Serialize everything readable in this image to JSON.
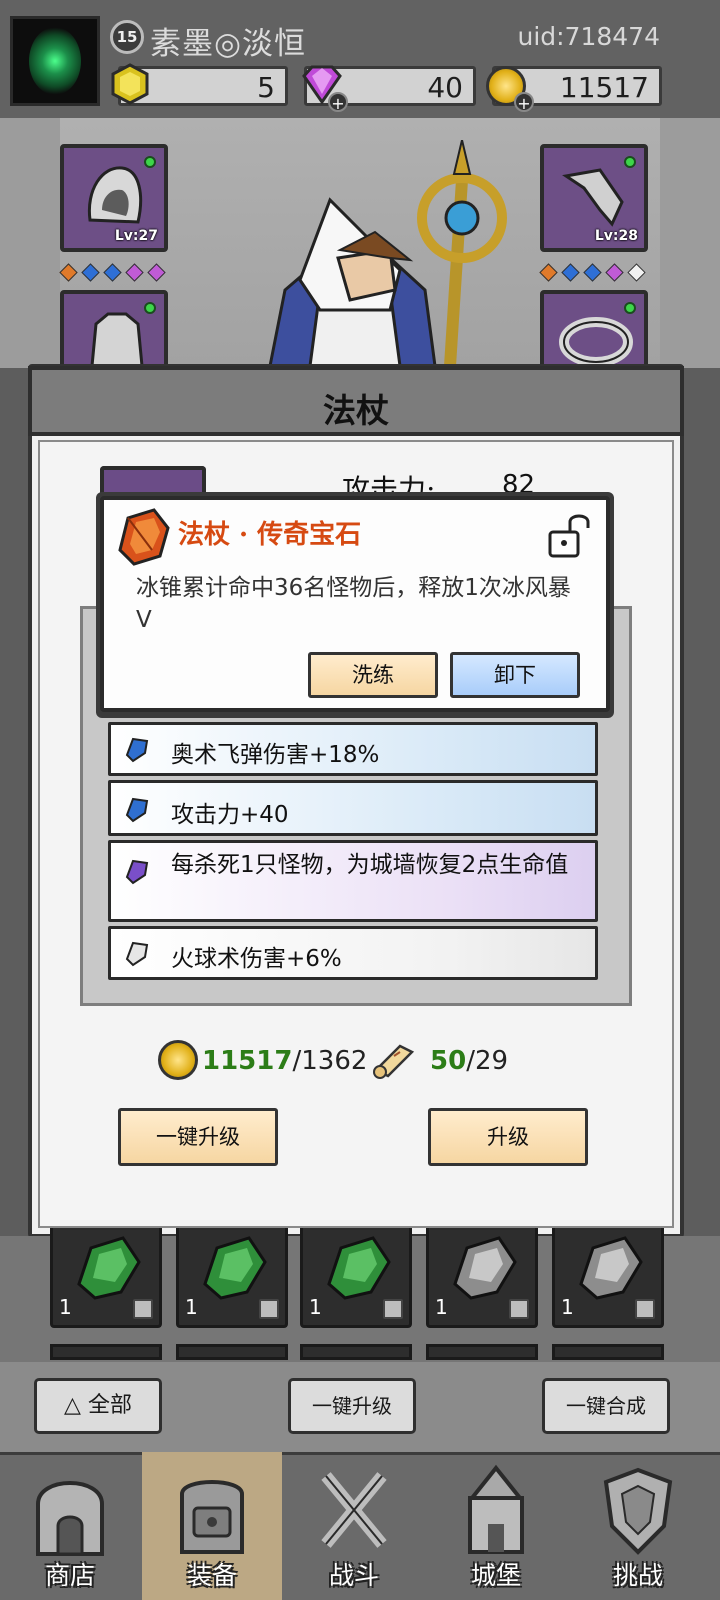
{
  "player": {
    "level": "15",
    "name": "素墨◎淡恒",
    "uid": "uid:718474"
  },
  "resources": {
    "gold_gem": "5",
    "diamond": "40",
    "coins": "11517"
  },
  "equipment": {
    "left_top_level": "Lv:27",
    "right_top_level": "Lv:28"
  },
  "panel": {
    "title": "法杖",
    "stat_label": "攻击力:",
    "stat_value": "82"
  },
  "popup": {
    "title": "法杖 · 传奇宝石",
    "description": "冰锥累计命中36名怪物后，释放1次冰风暴V",
    "reroll_label": "洗练",
    "unequip_label": "卸下"
  },
  "affixes": [
    {
      "text": "奥术飞弹伤害+18%",
      "gem_color": "#2f6fd1"
    },
    {
      "text": "攻击力+40",
      "gem_color": "#2f6fd1"
    },
    {
      "text": "每杀死1只怪物，为城墙恢复2点生命值",
      "gem_color": "#7a4fc9"
    },
    {
      "text": "火球术伤害+6%",
      "gem_color": "#e6e6e6"
    }
  ],
  "costs": {
    "coin_have": "11517",
    "coin_need": "/1362",
    "scroll_have": "50",
    "scroll_need": "/29"
  },
  "panel_buttons": {
    "upgrade_all": "一键升级",
    "upgrade": "升级"
  },
  "inventory": {
    "qty": "1"
  },
  "actions": {
    "filter_all": "全部",
    "upgrade_all": "一键升级",
    "merge_all": "一键合成"
  },
  "nav": [
    {
      "label": "商店"
    },
    {
      "label": "装备"
    },
    {
      "label": "战斗"
    },
    {
      "label": "城堡"
    },
    {
      "label": "挑战"
    }
  ],
  "colors": {
    "legend_orange": "#d64a12",
    "upgrade_green": "#2c7d17"
  }
}
